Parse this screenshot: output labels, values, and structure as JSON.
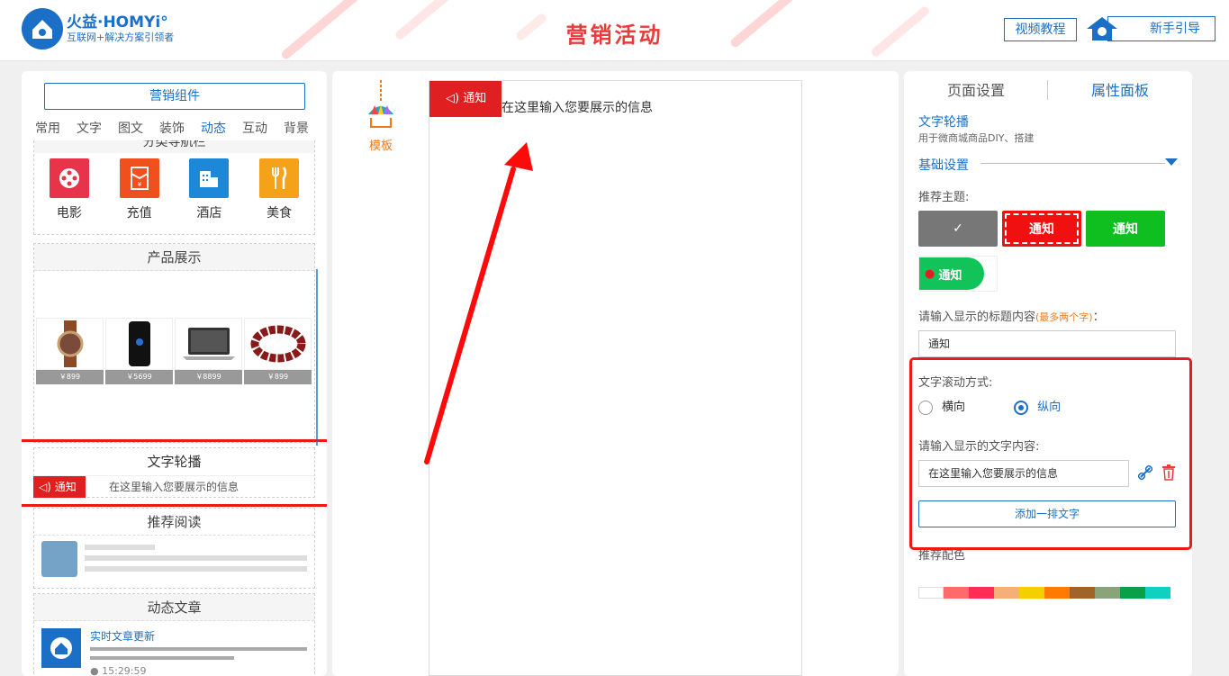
{
  "header": {
    "brand": "火益·HOMYi°",
    "slogan": "互联网+解决方案引领者",
    "title": "营销活动",
    "tutorial_label": "视频教程",
    "guide_label": "新手引导"
  },
  "left_panel": {
    "title": "营销组件",
    "categories": [
      "常用",
      "文字",
      "图文",
      "装饰",
      "动态",
      "互动",
      "背景"
    ],
    "active_category": "动态",
    "partial_block_title": "分类导航栏",
    "nav_items": [
      {
        "label": "电影",
        "icon": "film-icon",
        "color": "#e8344a"
      },
      {
        "label": "充值",
        "icon": "recharge-icon",
        "color": "#f0501e"
      },
      {
        "label": "酒店",
        "icon": "hotel-icon",
        "color": "#1e88d8"
      },
      {
        "label": "美食",
        "icon": "food-icon",
        "color": "#f5a21a"
      }
    ],
    "product_block_title": "产品展示",
    "products": [
      {
        "name": "watch",
        "price": "￥899"
      },
      {
        "name": "phone",
        "price": "￥5699"
      },
      {
        "name": "laptop",
        "price": "￥8899"
      },
      {
        "name": "bracelet",
        "price": "￥899"
      }
    ],
    "text_carousel_title": "文字轮播",
    "notice_badge": "通知",
    "notice_text": "在这里输入您要展示的信息",
    "reading_title": "推荐阅读",
    "article_title": "动态文章",
    "article_link": "实时文章更新",
    "article_time": "15:29:59"
  },
  "center": {
    "template_label": "模板",
    "notice_badge": "通知",
    "notice_text": "在这里输入您要展示的信息"
  },
  "right_panel": {
    "tabs": [
      "页面设置",
      "属性面板"
    ],
    "active_tab": "属性面板",
    "component_name": "文字轮播",
    "component_desc": "用于微商城商品DIY、搭建",
    "section_title": "基础设置",
    "theme_label": "推荐主题:",
    "themes": [
      {
        "label": "",
        "bg": "#777777"
      },
      {
        "label": "通知",
        "bg": "#f01010"
      },
      {
        "label": "通知",
        "bg": "#0fbf1f"
      },
      {
        "label": "通知",
        "bg": "#12c35a"
      }
    ],
    "title_label": "请输入显示的标题内容",
    "title_hint": "(最多两个字)",
    "title_colon": "：",
    "title_value": "通知",
    "scroll_label": "文字滚动方式:",
    "scroll_options": [
      "横向",
      "纵向"
    ],
    "scroll_selected": "纵向",
    "text_label": "请输入显示的文字内容:",
    "text_value": "在这里输入您要展示的信息",
    "add_button": "添加一排文字",
    "color_label": "推荐配色",
    "swatch_colors": [
      "#ffffff",
      "#ff6b6b",
      "#ff2d55",
      "#f5b07a",
      "#f5d000",
      "#ff7a00",
      "#a0642a",
      "#8aa37a",
      "#0aa04a",
      "#10d0c0"
    ]
  },
  "colors": {
    "accent": "#1b6fc7",
    "brand_red": "#e02020",
    "title_red": "#e83b3b",
    "highlight_frame": "#e81a1a"
  }
}
